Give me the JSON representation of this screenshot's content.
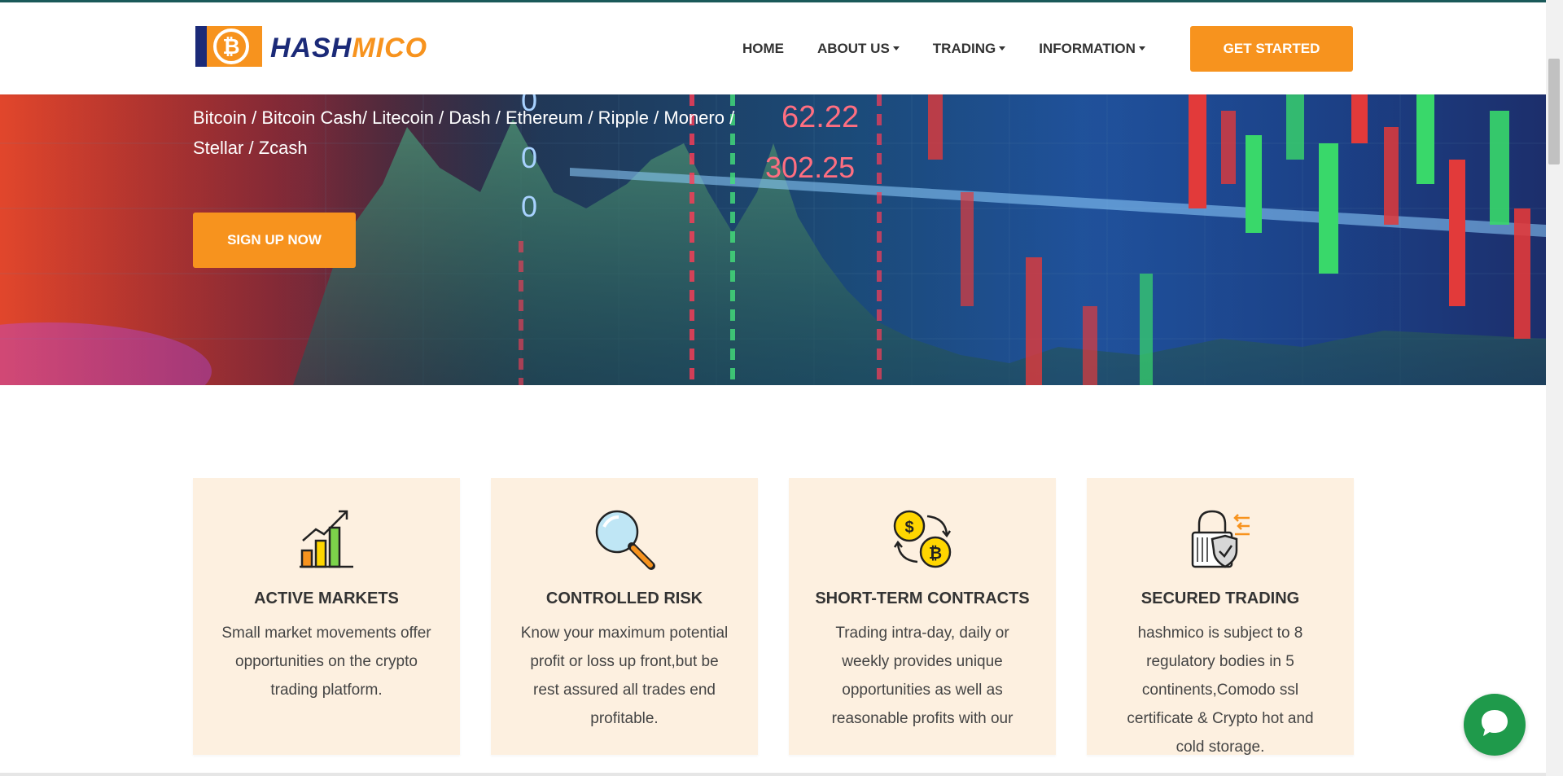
{
  "header": {
    "logo": {
      "text_part1": "HASH",
      "text_part2": "MICO",
      "icon": "bitcoin-logo-icon"
    },
    "nav": [
      {
        "label": "HOME",
        "has_dropdown": false
      },
      {
        "label": "ABOUT US",
        "has_dropdown": true
      },
      {
        "label": "TRADING",
        "has_dropdown": true
      },
      {
        "label": "INFORMATION",
        "has_dropdown": true
      }
    ],
    "cta_label": "GET STARTED"
  },
  "hero": {
    "coins_text": "Bitcoin / Bitcoin Cash/ Litecoin / Dash / Ethereum / Ripple / Monero / Stellar / Zcash",
    "signup_label": "SIGN UP NOW",
    "ticker_values": [
      "62.22",
      "302.25",
      "0",
      "0",
      "0"
    ]
  },
  "features": [
    {
      "icon": "growth-chart-icon",
      "title": "ACTIVE MARKETS",
      "text": "Small market movements offer opportunities on the crypto trading platform."
    },
    {
      "icon": "magnifier-icon",
      "title": "CONTROLLED RISK",
      "text": "Know your maximum potential profit or loss up front,but be rest assured all trades end profitable."
    },
    {
      "icon": "currency-exchange-icon",
      "title": "SHORT-TERM CONTRACTS",
      "text": "Trading intra-day, daily or weekly provides unique opportunities as well as reasonable profits with our"
    },
    {
      "icon": "security-lock-icon",
      "title": "SECURED TRADING",
      "text": "hashmico is subject to 8 regulatory bodies in 5 continents,Comodo ssl certificate & Crypto hot and cold storage."
    }
  ],
  "chat": {
    "icon": "chat-bubble-icon"
  },
  "colors": {
    "accent": "#f7931e",
    "brand_blue": "#1b2a78",
    "card_bg": "#fdf0e0",
    "chat_green": "#1f9a4b"
  }
}
